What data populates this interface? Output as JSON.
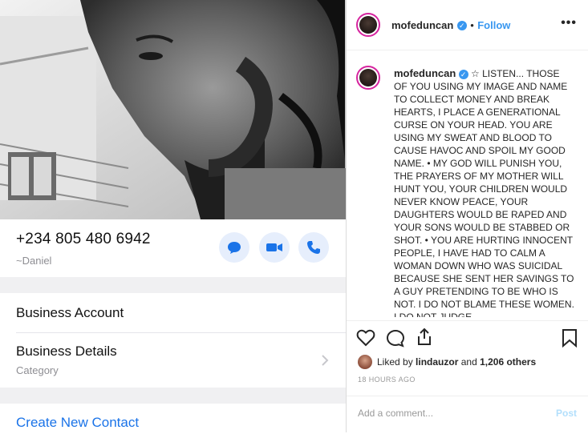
{
  "contact": {
    "phone": "+234 805 480 6942",
    "name": "~Daniel"
  },
  "sections": {
    "business_account": "Business Account",
    "business_details": "Business Details",
    "business_details_sub": "Category",
    "create_contact": "Create New Contact"
  },
  "post": {
    "username": "mofeduncan",
    "verified_mark": "✓",
    "dot": "•",
    "follow": "Follow",
    "more": "•••",
    "caption_user": "mofeduncan",
    "caption": "☆ LISTEN... THOSE OF YOU USING MY IMAGE AND NAME TO COLLECT MONEY AND BREAK HEARTS, I PLACE A GENERATIONAL CURSE ON YOUR HEAD. YOU ARE USING MY SWEAT AND BLOOD TO CAUSE HAVOC AND SPOIL MY GOOD NAME. • MY GOD WILL PUNISH YOU, THE PRAYERS OF MY MOTHER WILL HUNT YOU, YOUR CHILDREN WOULD NEVER KNOW PEACE, YOUR DAUGHTERS WOULD BE RAPED AND YOUR SONS WOULD BE STABBED OR SHOT. • YOU ARE HURTING INNOCENT PEOPLE, I HAVE HAD TO CALM A WOMAN DOWN WHO WAS SUICIDAL BECAUSE SHE SENT HER SAVINGS TO A GUY PRETENDING TO BE WHO IS NOT. I DO NOT BLAME THESE WOMEN. I DO NOT JUDGE",
    "liked_prefix": "Liked by",
    "liked_user": "lindauzor",
    "liked_suffix": "and",
    "liked_count": "1,206 others",
    "time": "18 HOURS AGO",
    "comment_placeholder": "Add a comment...",
    "post_button": "Post"
  },
  "colors": {
    "accent": "#3897f0",
    "ios_blue": "#1a73e8",
    "action_bg": "#e6eefc"
  },
  "icons": [
    "message-icon",
    "video-icon",
    "phone-icon",
    "heart-icon",
    "comment-icon",
    "share-icon",
    "bookmark-icon",
    "chevron-right-icon"
  ]
}
